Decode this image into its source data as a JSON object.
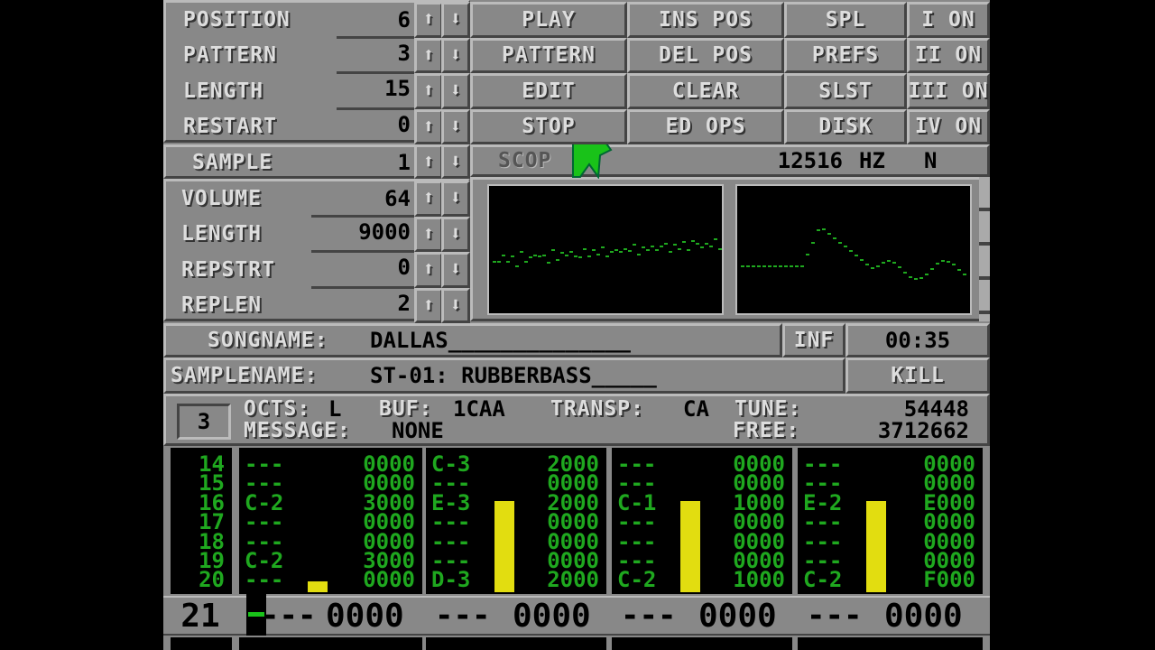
{
  "song": {
    "rows": [
      {
        "label": "POSITION",
        "value": "6"
      },
      {
        "label": "PATTERN",
        "value": "3"
      },
      {
        "label": "LENGTH",
        "value": "15"
      },
      {
        "label": "RESTART",
        "value": "0"
      }
    ]
  },
  "sample": {
    "label": "SAMPLE",
    "value": "1",
    "rows": [
      {
        "label": "VOLUME",
        "value": "64"
      },
      {
        "label": "LENGTH",
        "value": "9000"
      },
      {
        "label": "REPSTRT",
        "value": "0"
      },
      {
        "label": "REPLEN",
        "value": "2"
      }
    ]
  },
  "arrows": {
    "up": "⬆",
    "down": "⬇"
  },
  "buttons": {
    "col1": [
      "PLAY",
      "PATTERN",
      "EDIT",
      "STOP"
    ],
    "col2": [
      "INS POS",
      "DEL POS",
      "CLEAR",
      "ED OPS"
    ],
    "col3": [
      "SPL",
      "PREFS",
      "SLST",
      "DISK"
    ],
    "channels": [
      "I ON",
      "II ON",
      "III ON",
      "IV ON"
    ]
  },
  "scope": {
    "label": "SCOP",
    "freq": "12516",
    "unit": "HZ",
    "mode": "N"
  },
  "songname": {
    "label": "SONGNAME:",
    "value": "DALLAS______________"
  },
  "samplename": {
    "label": "SAMPLENAME:",
    "value": "ST-01: RUBBERBASS_____"
  },
  "inf_label": "INF",
  "time": "00:35",
  "kill_label": "KILL",
  "status": {
    "edit_step": "3",
    "octs_label": "OCTS:",
    "octs_value": "L",
    "buf_label": "BUF:",
    "buf_value": "1CAA",
    "transp_label": "TRANSP:",
    "transp_value": "CA",
    "tune_label": "TUNE:",
    "tune_value": "54448",
    "message_label": "MESSAGE:",
    "message_value": "NONE",
    "free_label": "FREE:",
    "free_value": "3712662"
  },
  "pattern": {
    "row_numbers": "14\n15\n16\n17\n18\n19\n20",
    "channels": [
      {
        "notes": "---\n---\nC-2\n---\n---\nC-2\n---",
        "effects": "0000\n0000\n3000\n0000\n0000\n3000\n0000",
        "vu_level": 0.08
      },
      {
        "notes": "C-3\n---\nE-3\n---\n---\n---\nD-3",
        "effects": "2000\n0000\n2000\n0000\n0000\n0000\n2000",
        "vu_level": 0.7
      },
      {
        "notes": "---\n---\nC-1\n---\n---\n---\nC-2",
        "effects": "0000\n0000\n1000\n0000\n0000\n0000\n1000",
        "vu_level": 0.7
      },
      {
        "notes": "---\n---\nE-2\n---\n---\n---\nC-2",
        "effects": "0000\n0000\nE000\n0000\n0000\n0000\nF000",
        "vu_level": 0.7
      }
    ],
    "current_row": {
      "number": "21",
      "cells": [
        {
          "note": "---",
          "effect": "0000"
        },
        {
          "note": "---",
          "effect": "0000"
        },
        {
          "note": "---",
          "effect": "0000"
        },
        {
          "note": "---",
          "effect": "0000"
        }
      ]
    }
  },
  "colors": {
    "panel": "#888888",
    "pattern_text": "#1fa81f",
    "vu": "#e2dd10",
    "cursor": "#19c219"
  }
}
